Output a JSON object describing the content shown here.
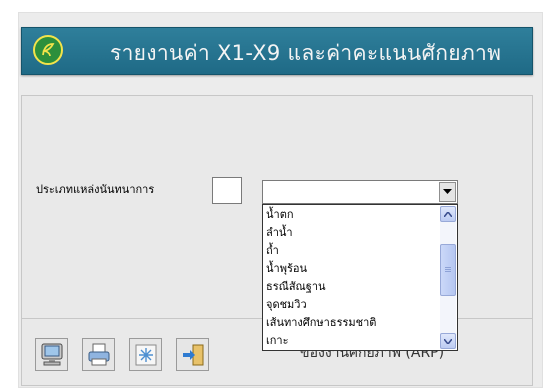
{
  "header": {
    "title": "รายงานค่า X1-X9 และค่าคะแนนศักยภาพ"
  },
  "form": {
    "type_label": "ประเภทแหล่งนันทนาการ",
    "code_value": "",
    "selected_value": ""
  },
  "dropdown": {
    "options": [
      "น้ำตก",
      "ลำน้ำ",
      "ถ้ำ",
      "น้ำพุร้อน",
      "ธรณีสัณฐาน",
      "จุดชมวิว",
      "เส้นทางศึกษาธรรมชาติ",
      "เกาะ"
    ]
  },
  "footer": {
    "partial_text": "ของงานศักยภาพ (ARP)"
  },
  "toolbar": {
    "icons": [
      "monitor-icon",
      "printer-icon",
      "refresh-icon",
      "exit-icon"
    ]
  },
  "colors": {
    "banner": "#2a7895",
    "scrollbar": "#bccbf2"
  }
}
